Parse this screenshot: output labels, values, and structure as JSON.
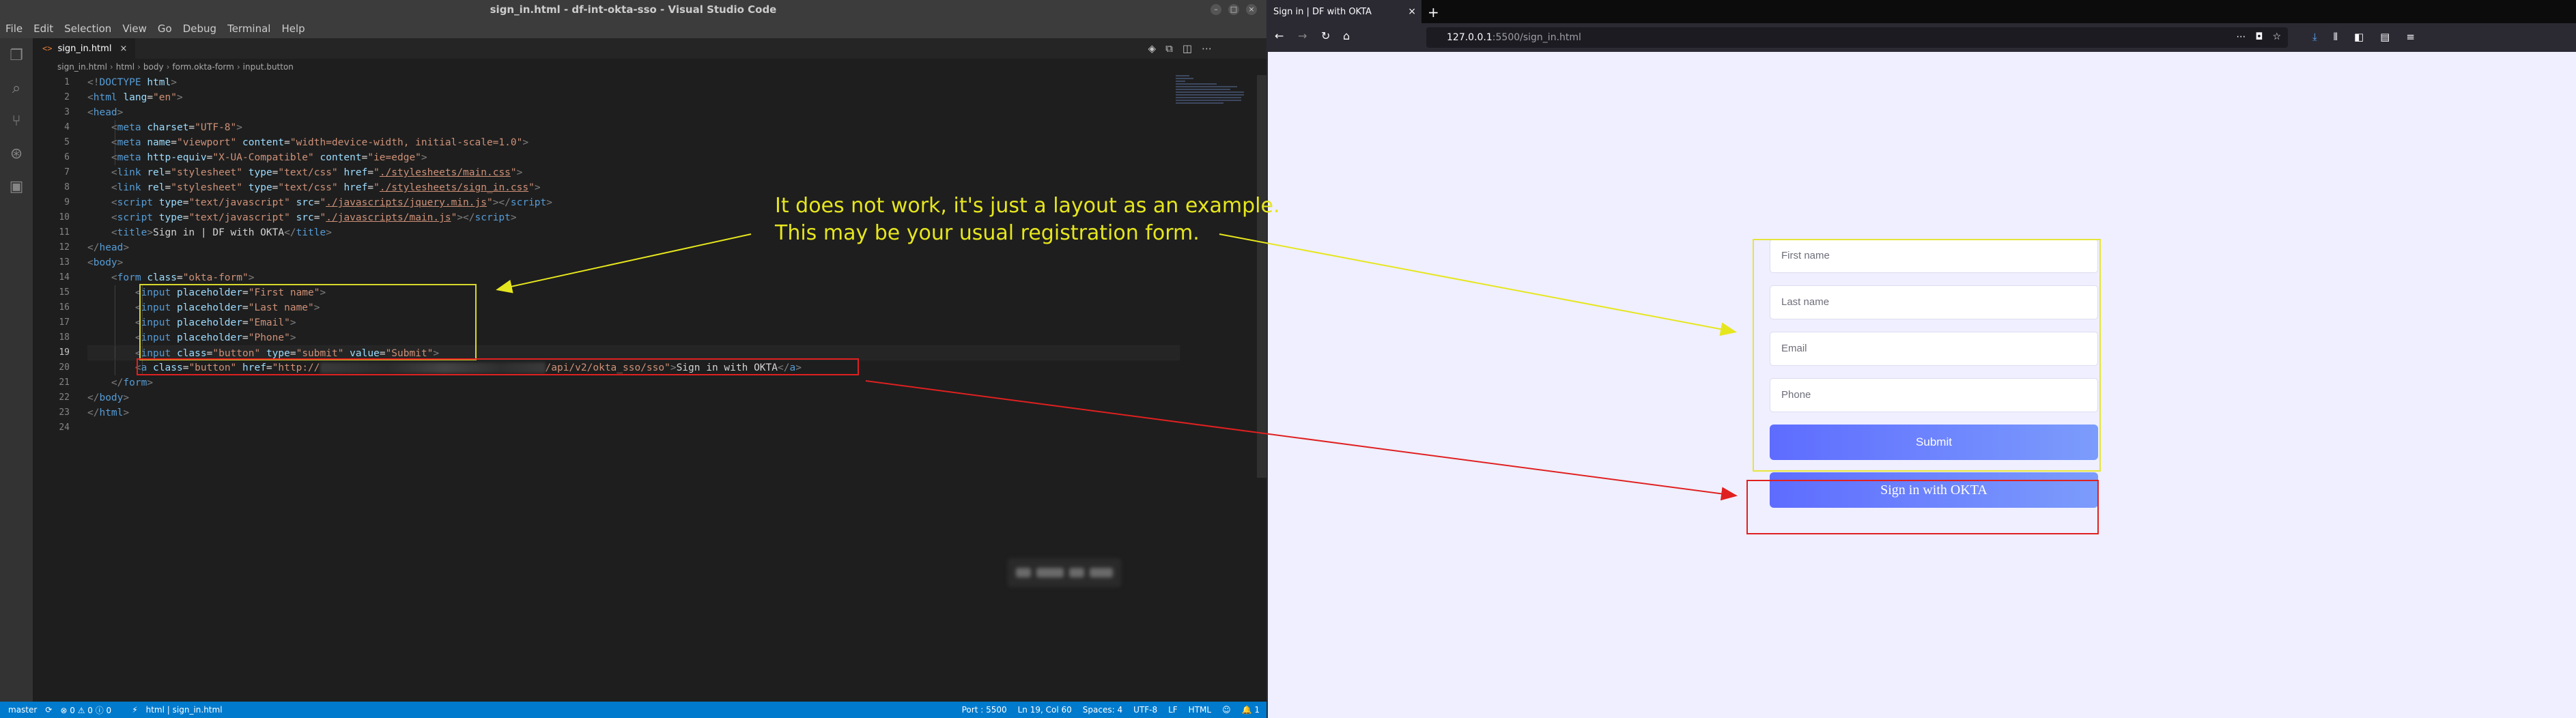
{
  "vscode": {
    "window_title": "sign_in.html - df-int-okta-sso - Visual Studio Code",
    "menu": [
      "File",
      "Edit",
      "Selection",
      "View",
      "Go",
      "Debug",
      "Terminal",
      "Help"
    ],
    "tab": {
      "lang": "<>",
      "name": "sign_in.html",
      "close": "×"
    },
    "breadcrumb": [
      "sign_in.html",
      "html",
      "body",
      "form.okta-form",
      "input.button"
    ],
    "line_numbers": [
      "1",
      "2",
      "3",
      "4",
      "5",
      "6",
      "7",
      "8",
      "9",
      "10",
      "11",
      "12",
      "13",
      "14",
      "15",
      "16",
      "17",
      "18",
      "19",
      "20",
      "21",
      "22",
      "23",
      "24"
    ],
    "active_line": "19",
    "status": {
      "branch": "master",
      "sync": "⟳",
      "problems": "⊗ 0 ⚠ 0 ⓘ 0",
      "bolt": "⚡",
      "breadcrumb": "html | sign_in.html",
      "port": "Port : 5500",
      "cursor": "Ln 19, Col 60",
      "spaces": "Spaces: 4",
      "encoding": "UTF-8",
      "eol": "LF",
      "language": "HTML",
      "bell": "1"
    }
  },
  "annotation": {
    "line1": "It does not work, it's just a layout as an example.",
    "line2": "This may be your usual registration form."
  },
  "firefox": {
    "tab_title": "Sign in | DF with OKTA",
    "url_host": "127.0.0.1",
    "url_path": ":5500/sign_in.html",
    "form": {
      "first_name": "First name",
      "last_name": "Last name",
      "email": "Email",
      "phone": "Phone",
      "submit": "Submit",
      "okta_link": "Sign in with OKTA"
    }
  },
  "colors": {
    "accent_blue": "#007acc",
    "annotation_yellow": "#e6e61e",
    "annotation_red": "#e02020",
    "button_gradient_start": "#5e6cff",
    "button_gradient_end": "#7c9cfc"
  }
}
